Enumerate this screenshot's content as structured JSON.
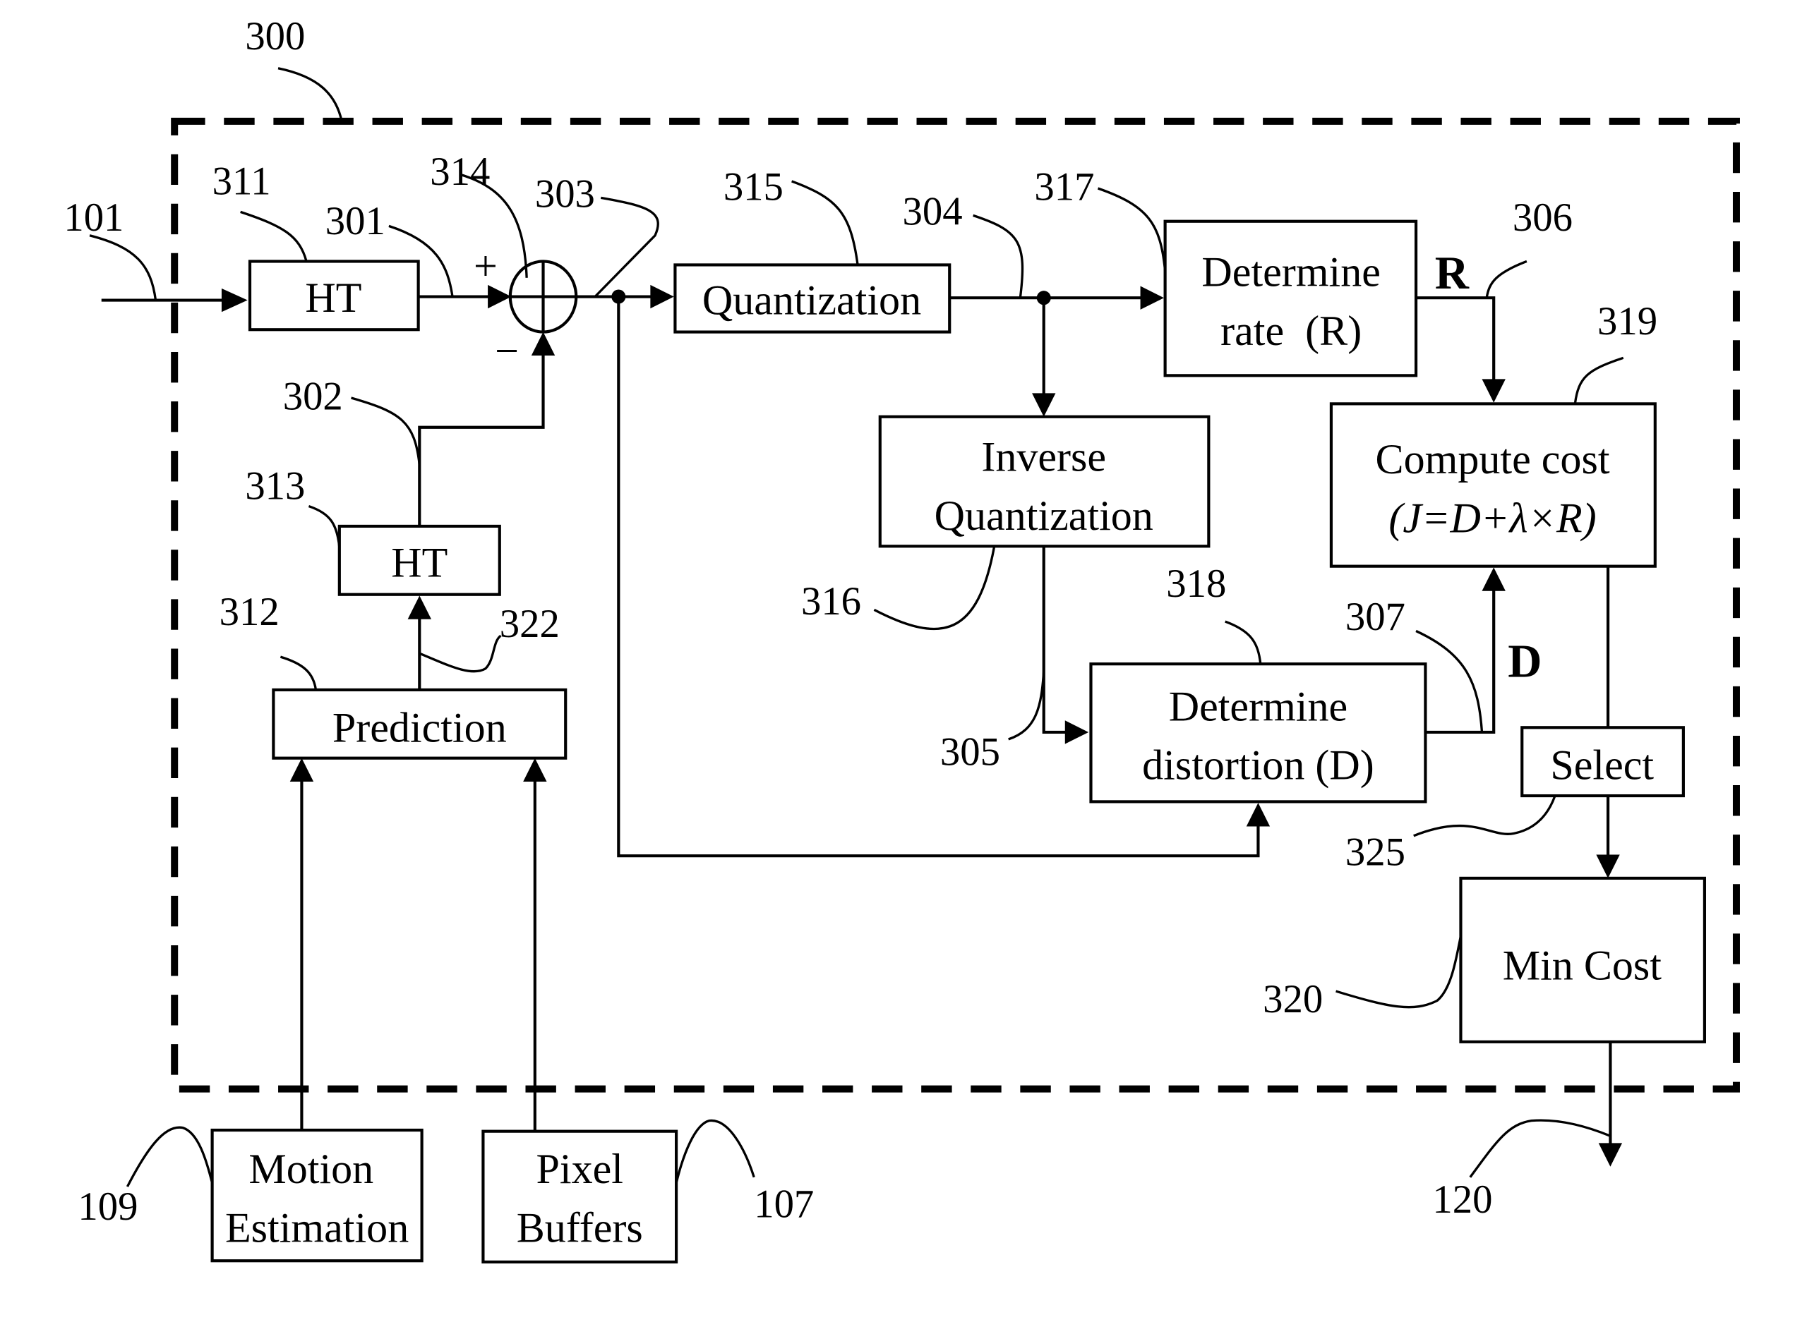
{
  "figure": {
    "boundary_ref": "300",
    "blocks": {
      "ht_input": {
        "text": "HT",
        "ref": "311"
      },
      "ht_prediction": {
        "text": "HT",
        "ref": "313"
      },
      "prediction": {
        "text": "Prediction",
        "ref": "312"
      },
      "quantization": {
        "text": "Quantization",
        "ref": "315"
      },
      "inverse_quantization": {
        "lines": [
          "Inverse",
          "Quantization"
        ],
        "ref": "316"
      },
      "determine_rate": {
        "lines": [
          "Determine",
          "rate  (R)"
        ],
        "ref": "317"
      },
      "compute_cost": {
        "lines": [
          "Compute cost",
          "(J=D+λ×R)"
        ],
        "ref": "319"
      },
      "determine_distortion": {
        "lines": [
          "Determine",
          "distortion (D)"
        ],
        "ref": "318"
      },
      "select": {
        "text": "Select",
        "ref": "325"
      },
      "min_cost": {
        "text": "Min Cost",
        "ref": "320"
      },
      "motion_estimation": {
        "lines": [
          "Motion",
          "Estimation"
        ],
        "ref": "109"
      },
      "pixel_buffers": {
        "lines": [
          "Pixel",
          "Buffers"
        ],
        "ref": "107"
      }
    },
    "adder": {
      "ref": "314",
      "plus": "+",
      "minus": "−"
    },
    "signals": {
      "input": "101",
      "ht_output": "301",
      "prediction_ht": "302",
      "residual": "303",
      "quantized": "304",
      "dequantized": "305",
      "rate": "306",
      "distortion": "307",
      "prediction_out": "322",
      "output": "120"
    },
    "signal_letters": {
      "rate": "R",
      "distortion": "D"
    }
  }
}
